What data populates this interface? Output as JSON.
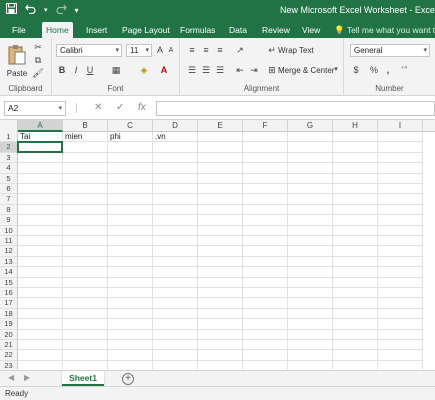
{
  "window": {
    "title": "New Microsoft Excel Worksheet - Excel"
  },
  "qat": {
    "save_icon": "save-icon",
    "undo_icon": "undo-icon",
    "redo_icon": "redo-icon",
    "customize_icon": "customize-qat-icon"
  },
  "tabs": [
    {
      "label": "File"
    },
    {
      "label": "Home"
    },
    {
      "label": "Insert"
    },
    {
      "label": "Page Layout"
    },
    {
      "label": "Formulas"
    },
    {
      "label": "Data"
    },
    {
      "label": "Review"
    },
    {
      "label": "View"
    }
  ],
  "tell_me": "Tell me what you want to",
  "ribbon": {
    "clipboard": {
      "label": "Clipboard",
      "paste_label": "Paste"
    },
    "font": {
      "label": "Font",
      "font_name": "Calibri",
      "font_size": "11",
      "bold": "B",
      "italic": "I",
      "underline": "U",
      "grow": "A",
      "shrink": "A",
      "font_color_glyph": "A"
    },
    "alignment": {
      "label": "Alignment",
      "wrap_text": "Wrap Text",
      "merge_center": "Merge & Center"
    },
    "number": {
      "label": "Number",
      "format": "General",
      "currency": "$",
      "percent": "%",
      "comma": ","
    }
  },
  "formula_bar": {
    "name_box": "A2",
    "cancel_glyph": "✕",
    "enter_glyph": "✓",
    "fx_glyph": "fx",
    "value": ""
  },
  "grid": {
    "columns": [
      "A",
      "B",
      "C",
      "D",
      "E",
      "F",
      "G",
      "H",
      "I"
    ],
    "rows": [
      "1",
      "2",
      "3",
      "4",
      "5",
      "6",
      "7",
      "8",
      "9",
      "10",
      "11",
      "12",
      "13",
      "14",
      "15",
      "16",
      "17",
      "18",
      "19",
      "20",
      "21",
      "22",
      "23"
    ],
    "cells": {
      "A1": "Tai",
      "B1": "mien",
      "C1": "phi",
      "D1": ".vn"
    },
    "active_cell": "A2",
    "gridline_color": "#e1e1e1",
    "accent": "#217346"
  },
  "sheets": [
    {
      "label": "Sheet1",
      "active": true
    }
  ],
  "add_sheet_glyph": "⊕",
  "status": {
    "text": "Ready"
  },
  "colors": {
    "brand": "#217346",
    "ribbon_bg": "#f3f3f3"
  }
}
